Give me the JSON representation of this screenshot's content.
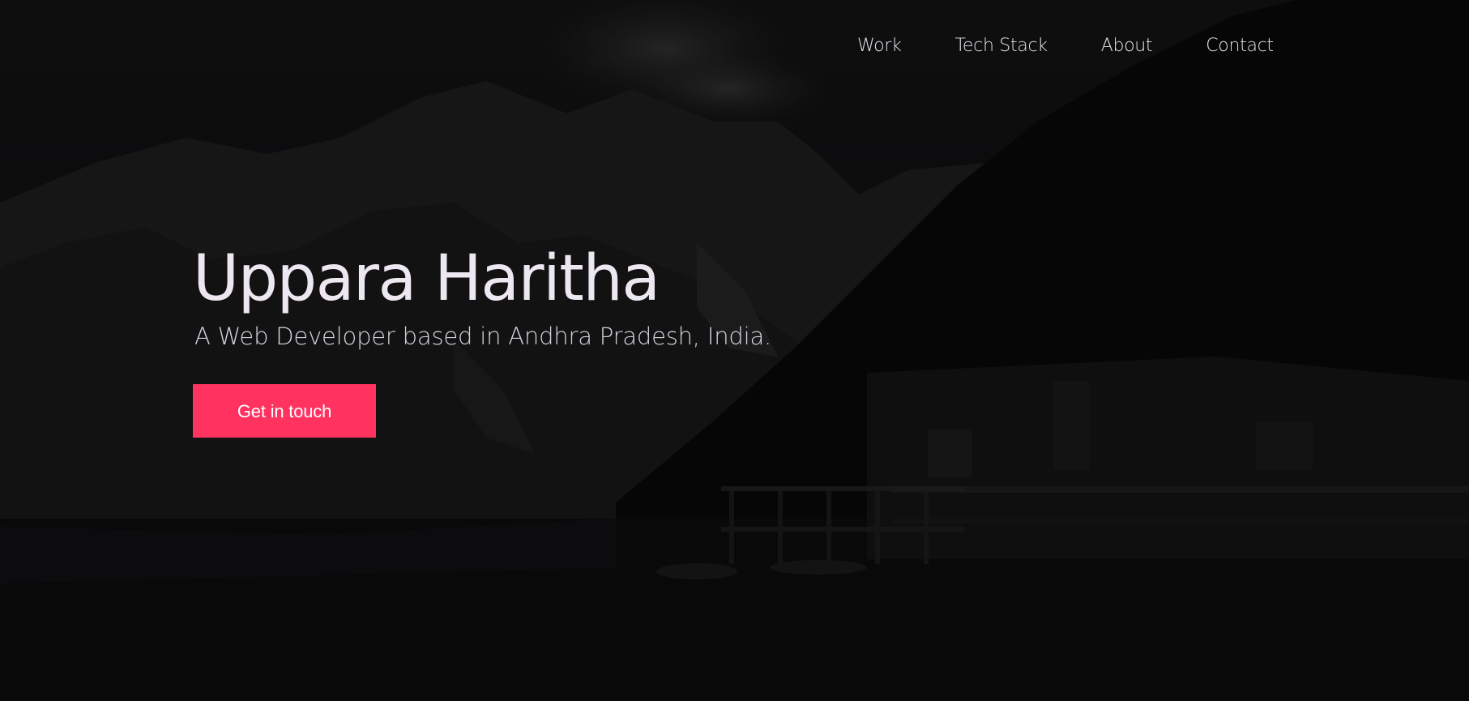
{
  "nav": {
    "items": [
      {
        "label": "Work"
      },
      {
        "label": "Tech Stack"
      },
      {
        "label": "About"
      },
      {
        "label": "Contact"
      }
    ]
  },
  "hero": {
    "title": "Uppara Haritha",
    "subtitle": "A Web Developer based in Andhra Pradesh, India.",
    "cta_label": "Get in touch"
  },
  "colors": {
    "accent": "#ff3260",
    "background": "#0b0b0c",
    "text": "#ece7f0"
  }
}
